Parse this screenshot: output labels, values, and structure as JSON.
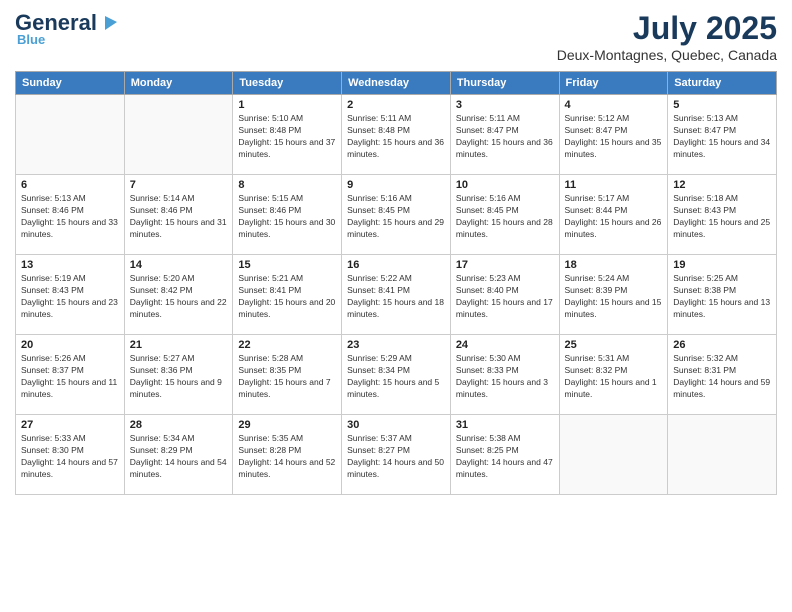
{
  "logo": {
    "line1": "General",
    "line2": "Blue",
    "tagline": ""
  },
  "title": "July 2025",
  "subtitle": "Deux-Montagnes, Quebec, Canada",
  "headers": [
    "Sunday",
    "Monday",
    "Tuesday",
    "Wednesday",
    "Thursday",
    "Friday",
    "Saturday"
  ],
  "weeks": [
    [
      {
        "day": "",
        "detail": ""
      },
      {
        "day": "",
        "detail": ""
      },
      {
        "day": "1",
        "detail": "Sunrise: 5:10 AM\nSunset: 8:48 PM\nDaylight: 15 hours and 37 minutes."
      },
      {
        "day": "2",
        "detail": "Sunrise: 5:11 AM\nSunset: 8:48 PM\nDaylight: 15 hours and 36 minutes."
      },
      {
        "day": "3",
        "detail": "Sunrise: 5:11 AM\nSunset: 8:47 PM\nDaylight: 15 hours and 36 minutes."
      },
      {
        "day": "4",
        "detail": "Sunrise: 5:12 AM\nSunset: 8:47 PM\nDaylight: 15 hours and 35 minutes."
      },
      {
        "day": "5",
        "detail": "Sunrise: 5:13 AM\nSunset: 8:47 PM\nDaylight: 15 hours and 34 minutes."
      }
    ],
    [
      {
        "day": "6",
        "detail": "Sunrise: 5:13 AM\nSunset: 8:46 PM\nDaylight: 15 hours and 33 minutes."
      },
      {
        "day": "7",
        "detail": "Sunrise: 5:14 AM\nSunset: 8:46 PM\nDaylight: 15 hours and 31 minutes."
      },
      {
        "day": "8",
        "detail": "Sunrise: 5:15 AM\nSunset: 8:46 PM\nDaylight: 15 hours and 30 minutes."
      },
      {
        "day": "9",
        "detail": "Sunrise: 5:16 AM\nSunset: 8:45 PM\nDaylight: 15 hours and 29 minutes."
      },
      {
        "day": "10",
        "detail": "Sunrise: 5:16 AM\nSunset: 8:45 PM\nDaylight: 15 hours and 28 minutes."
      },
      {
        "day": "11",
        "detail": "Sunrise: 5:17 AM\nSunset: 8:44 PM\nDaylight: 15 hours and 26 minutes."
      },
      {
        "day": "12",
        "detail": "Sunrise: 5:18 AM\nSunset: 8:43 PM\nDaylight: 15 hours and 25 minutes."
      }
    ],
    [
      {
        "day": "13",
        "detail": "Sunrise: 5:19 AM\nSunset: 8:43 PM\nDaylight: 15 hours and 23 minutes."
      },
      {
        "day": "14",
        "detail": "Sunrise: 5:20 AM\nSunset: 8:42 PM\nDaylight: 15 hours and 22 minutes."
      },
      {
        "day": "15",
        "detail": "Sunrise: 5:21 AM\nSunset: 8:41 PM\nDaylight: 15 hours and 20 minutes."
      },
      {
        "day": "16",
        "detail": "Sunrise: 5:22 AM\nSunset: 8:41 PM\nDaylight: 15 hours and 18 minutes."
      },
      {
        "day": "17",
        "detail": "Sunrise: 5:23 AM\nSunset: 8:40 PM\nDaylight: 15 hours and 17 minutes."
      },
      {
        "day": "18",
        "detail": "Sunrise: 5:24 AM\nSunset: 8:39 PM\nDaylight: 15 hours and 15 minutes."
      },
      {
        "day": "19",
        "detail": "Sunrise: 5:25 AM\nSunset: 8:38 PM\nDaylight: 15 hours and 13 minutes."
      }
    ],
    [
      {
        "day": "20",
        "detail": "Sunrise: 5:26 AM\nSunset: 8:37 PM\nDaylight: 15 hours and 11 minutes."
      },
      {
        "day": "21",
        "detail": "Sunrise: 5:27 AM\nSunset: 8:36 PM\nDaylight: 15 hours and 9 minutes."
      },
      {
        "day": "22",
        "detail": "Sunrise: 5:28 AM\nSunset: 8:35 PM\nDaylight: 15 hours and 7 minutes."
      },
      {
        "day": "23",
        "detail": "Sunrise: 5:29 AM\nSunset: 8:34 PM\nDaylight: 15 hours and 5 minutes."
      },
      {
        "day": "24",
        "detail": "Sunrise: 5:30 AM\nSunset: 8:33 PM\nDaylight: 15 hours and 3 minutes."
      },
      {
        "day": "25",
        "detail": "Sunrise: 5:31 AM\nSunset: 8:32 PM\nDaylight: 15 hours and 1 minute."
      },
      {
        "day": "26",
        "detail": "Sunrise: 5:32 AM\nSunset: 8:31 PM\nDaylight: 14 hours and 59 minutes."
      }
    ],
    [
      {
        "day": "27",
        "detail": "Sunrise: 5:33 AM\nSunset: 8:30 PM\nDaylight: 14 hours and 57 minutes."
      },
      {
        "day": "28",
        "detail": "Sunrise: 5:34 AM\nSunset: 8:29 PM\nDaylight: 14 hours and 54 minutes."
      },
      {
        "day": "29",
        "detail": "Sunrise: 5:35 AM\nSunset: 8:28 PM\nDaylight: 14 hours and 52 minutes."
      },
      {
        "day": "30",
        "detail": "Sunrise: 5:37 AM\nSunset: 8:27 PM\nDaylight: 14 hours and 50 minutes."
      },
      {
        "day": "31",
        "detail": "Sunrise: 5:38 AM\nSunset: 8:25 PM\nDaylight: 14 hours and 47 minutes."
      },
      {
        "day": "",
        "detail": ""
      },
      {
        "day": "",
        "detail": ""
      }
    ]
  ]
}
